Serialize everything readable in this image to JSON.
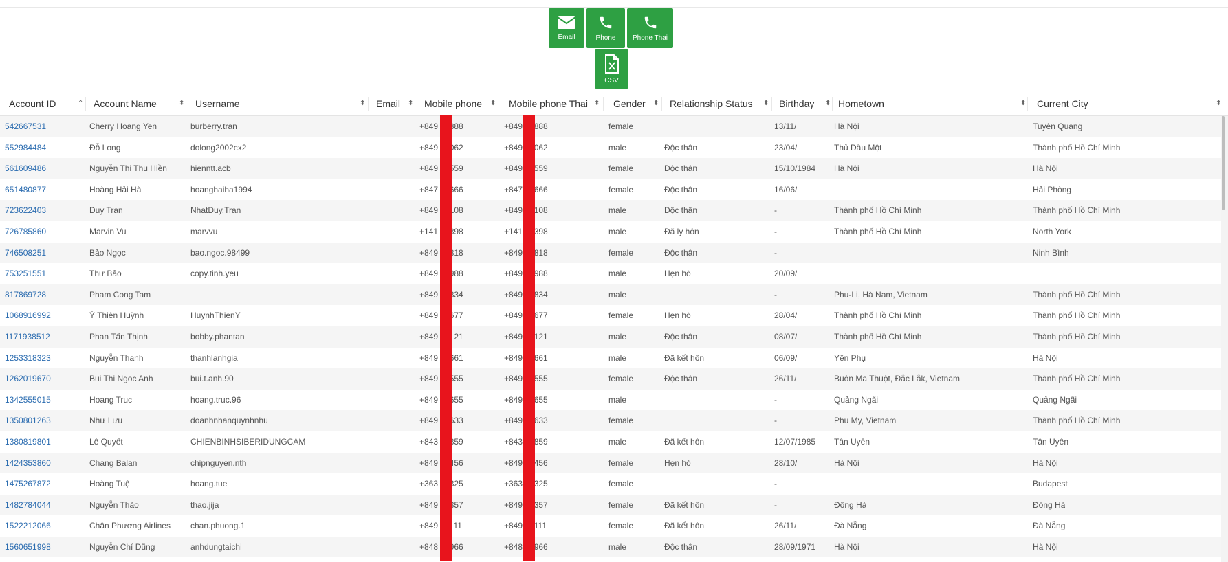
{
  "exports": {
    "email_label": "Email",
    "phone_label": "Phone",
    "phone_thai_label": "Phone Thai",
    "csv_label": "CSV",
    "color": "#2ea043"
  },
  "columns": [
    "Account ID",
    "Account Name",
    "Username",
    "Email",
    "Mobile phone",
    "Mobile phone Thai",
    "Gender",
    "Relationship Status",
    "Birthday",
    "Hometown",
    "Current City"
  ],
  "sort_indicators": {
    "asc": "⌃",
    "both": "⬍"
  },
  "rows": [
    [
      "542667531",
      "Cherry Hoang Yen",
      "burberry.tran",
      "",
      "+849  16888",
      "+849  16888",
      "female",
      "",
      "13/11/",
      "Hà Nội",
      "Tuyên Quang"
    ],
    [
      "552984484",
      "Đỗ Long",
      "dolong2002cx2",
      "",
      "+849  39062",
      "+849  39062",
      "male",
      "Độc thân",
      "23/04/",
      "Thủ Dầu Một",
      "Thành phố Hồ Chí Minh"
    ],
    [
      "561609486",
      "Nguyễn Thị Thu Hiền",
      "hienntt.acb",
      "",
      "+849  19559",
      "+849  19559",
      "female",
      "Độc thân",
      "15/10/1984",
      "Hà Nội",
      "Hà Nội"
    ],
    [
      "651480877",
      "Hoàng Hải Hà",
      "hoanghaiha1994",
      "",
      "+847  32666",
      "+847  32666",
      "female",
      "Độc thân",
      "16/06/",
      "",
      "Hải Phòng"
    ],
    [
      "723622403",
      "Duy Tran",
      "NhatDuy.Tran",
      "",
      "+849  35108",
      "+849  35108",
      "male",
      "Độc thân",
      "-",
      "Thành phố Hồ Chí Minh",
      "Thành phố Hồ Chí Minh"
    ],
    [
      "726785860",
      "Marvin Vu",
      "marvvu",
      "",
      "+141  06398",
      "+141  06398",
      "male",
      "Đã ly hôn",
      "-",
      "Thành phố Hồ Chí Minh",
      "North York"
    ],
    [
      "746508251",
      "Bảo Ngọc",
      "bao.ngoc.98499",
      "",
      "+849  68818",
      "+849  68818",
      "female",
      "Độc thân",
      "-",
      "",
      "Ninh Bình"
    ],
    [
      "753251551",
      "Thư Bảo",
      "copy.tinh.yeu",
      "",
      "+849  85988",
      "+849  85988",
      "male",
      "Hẹn hò",
      "20/09/",
      "",
      ""
    ],
    [
      "817869728",
      "Pham Cong Tam",
      "",
      "",
      "+849  44834",
      "+849  44834",
      "male",
      "",
      "-",
      "Phu-Li, Hà Nam, Vietnam",
      "Thành phố Hồ Chí Minh"
    ],
    [
      "1068916992",
      "Ý Thiên Huỳnh",
      "HuynhThienY",
      "",
      "+849  72677",
      "+849  72677",
      "female",
      "Hẹn hò",
      "28/04/",
      "Thành phố Hồ Chí Minh",
      "Thành phố Hồ Chí Minh"
    ],
    [
      "1171938512",
      "Phan Tấn Thịnh",
      "bobby.phantan",
      "",
      "+849  72121",
      "+849  72121",
      "male",
      "Độc thân",
      "08/07/",
      "Thành phố Hồ Chí Minh",
      "Thành phố Hồ Chí Minh"
    ],
    [
      "1253318323",
      "Nguyễn Thanh",
      "thanhlanhgia",
      "",
      "+849  62661",
      "+849  62661",
      "male",
      "Đã kết hôn",
      "06/09/",
      "Yên Phụ",
      "Hà Nội"
    ],
    [
      "1262019670",
      "Bui Thi Ngoc Anh",
      "bui.t.anh.90",
      "",
      "+849  74555",
      "+849  74555",
      "female",
      "Độc thân",
      "26/11/",
      "Buôn Ma Thuột, Đắc Lắk, Vietnam",
      "Thành phố Hồ Chí Minh"
    ],
    [
      "1342555015",
      "Hoang Truc",
      "hoang.truc.96",
      "",
      "+849  60655",
      "+849  60655",
      "male",
      "",
      "-",
      "Quảng Ngãi",
      "Quảng Ngãi"
    ],
    [
      "1350801263",
      "Như Lưu",
      "doanhnhanquynhnhu",
      "",
      "+849  30633",
      "+849  30633",
      "female",
      "",
      "-",
      "Phu My, Vietnam",
      "Thành phố Hồ Chí Minh"
    ],
    [
      "1380819801",
      "Lê Quyết",
      "CHIENBINHSIBERIDUNGCAM",
      "",
      "+843  57859",
      "+843  57859",
      "male",
      "Đã kết hôn",
      "12/07/1985",
      "Tân Uyên",
      "Tân Uyên"
    ],
    [
      "1424353860",
      "Chang Balan",
      "chipnguyen.nth",
      "",
      "+849  09456",
      "+849  09456",
      "female",
      "Hẹn hò",
      "28/10/",
      "Hà Nội",
      "Hà Nội"
    ],
    [
      "1475267872",
      "Hoàng Tuệ",
      "hoang.tue",
      "",
      "+363  81325",
      "+363  81325",
      "female",
      "",
      "-",
      "",
      "Budapest"
    ],
    [
      "1482784044",
      "Nguyễn Thảo",
      "thao.jija",
      "",
      "+849  59357",
      "+849  59357",
      "female",
      "Đã kết hôn",
      "-",
      "Đông Hà",
      "Đông Hà"
    ],
    [
      "1522212066",
      "Chân Phương Airlines",
      "chan.phuong.1",
      "",
      "+849  60111",
      "+849  60111",
      "female",
      "Đã kết hôn",
      "26/11/",
      "Đà Nẵng",
      "Đà Nẵng"
    ],
    [
      "1560651998",
      "Nguyễn Chí Dũng",
      "anhdungtaichi",
      "",
      "+848  89966",
      "+848  89966",
      "male",
      "Độc thân",
      "28/09/1971",
      "Hà Nội",
      "Hà Nội"
    ]
  ],
  "redaction_color": "#e8141c",
  "link_color": "#2b6cb0"
}
